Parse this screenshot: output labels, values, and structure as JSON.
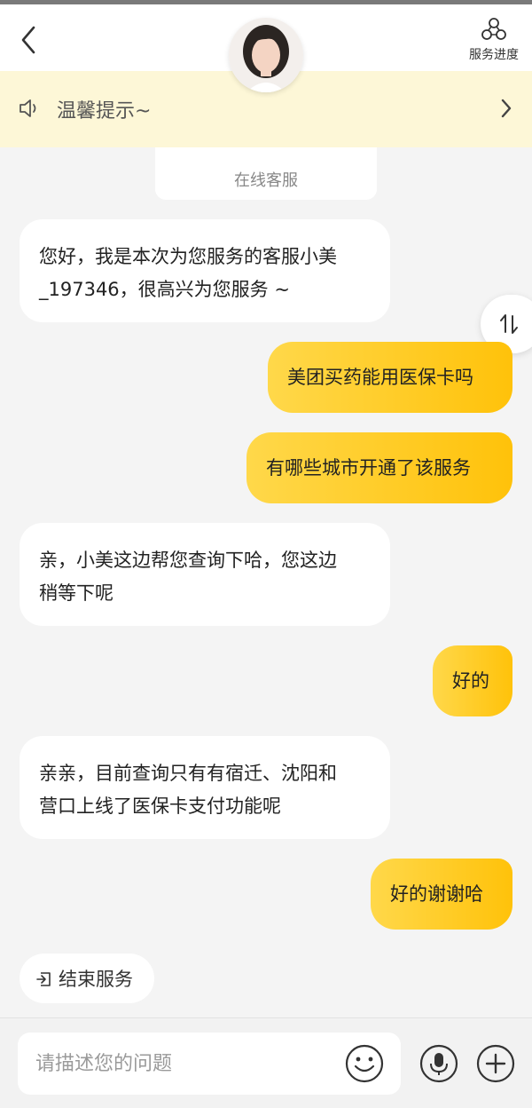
{
  "header": {
    "back_icon": "chevron-left-icon",
    "avatar_icon": "agent-avatar",
    "progress_label": "服务进度",
    "progress_icon": "nodes-icon"
  },
  "notice": {
    "text": "温馨提示~",
    "icon": "speaker-icon",
    "chevron_icon": "chevron-right-icon"
  },
  "info_card": {
    "label": "在线客服"
  },
  "messages": [
    {
      "side": "left",
      "lines": [
        "您好，我是本次为您服务的客服小美",
        "_197346，很高兴为您服务 ~"
      ]
    },
    {
      "side": "right",
      "text": "美团买药能用医保卡吗"
    },
    {
      "side": "right",
      "text": "有哪些城市开通了该服务"
    },
    {
      "side": "left",
      "lines": [
        "亲，小美这边帮您查询下哈，您这边",
        "稍等下呢"
      ]
    },
    {
      "side": "right",
      "text": "好的"
    },
    {
      "side": "left",
      "lines": [
        "亲亲，目前查询只有有宿迁、沈阳和",
        "营口上线了医保卡支付功能呢"
      ]
    },
    {
      "side": "right",
      "text": "好的谢谢哈"
    }
  ],
  "end_service": {
    "label": "结束服务",
    "icon": "exit-icon"
  },
  "composer": {
    "placeholder": "请描述您的问题",
    "emoji_icon": "smiley-icon",
    "mic_icon": "microphone-icon",
    "plus_icon": "plus-icon"
  },
  "colors": {
    "accent": "#ffc20a",
    "notice_bg": "#fdf7d7",
    "page_bg": "#f4f4f4"
  }
}
